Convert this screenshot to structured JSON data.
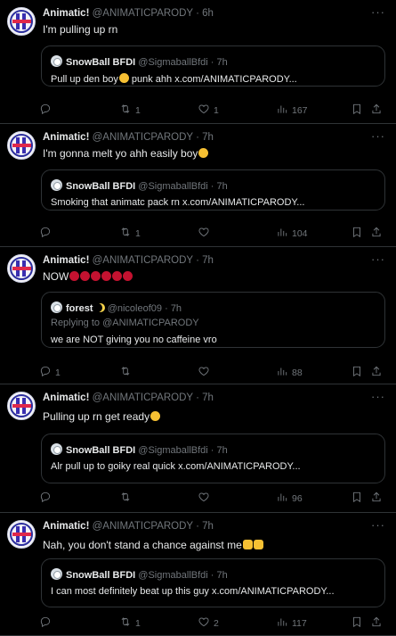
{
  "tweets": [
    {
      "name": "Animatic!",
      "handle": "@ANIMATICPARODY",
      "sep": "·",
      "time": "6h",
      "text": "I'm pulling up rn",
      "emojis": [],
      "quote": {
        "name": "SnowBall BFDI",
        "handle": "@SigmaballBfdi",
        "sep": "·",
        "time": "7h",
        "reply_to": "",
        "text_before": "Pull up den boy",
        "emoji": "yellow",
        "text_after": " punk ahh x.com/ANIMATICPARODY..."
      },
      "stats": {
        "replies": "",
        "retweets": "1",
        "likes": "1",
        "views": "167"
      }
    },
    {
      "name": "Animatic!",
      "handle": "@ANIMATICPARODY",
      "sep": "·",
      "time": "7h",
      "text": "I'm gonna melt yo ahh easily boy",
      "emojis": [
        "yellow"
      ],
      "quote": {
        "name": "SnowBall BFDI",
        "handle": "@SigmaballBfdi",
        "sep": "·",
        "time": "7h",
        "reply_to": "",
        "text_before": "Smoking that animatc pack rn x.com/ANIMATICPARODY...",
        "emoji": "",
        "text_after": ""
      },
      "stats": {
        "replies": "",
        "retweets": "1",
        "likes": "",
        "views": "104"
      }
    },
    {
      "name": "Animatic!",
      "handle": "@ANIMATICPARODY",
      "sep": "·",
      "time": "7h",
      "text": "NOW",
      "emojis": [
        "red",
        "red",
        "red",
        "red",
        "red",
        "red"
      ],
      "quote": {
        "name": "forest",
        "handle": "@nicoleof09",
        "sep": "·",
        "time": "7h",
        "reply_to": "Replying to @ANIMATICPARODY",
        "text_before": "we are NOT giving you no caffeine vro",
        "emoji": "",
        "text_after": ""
      },
      "stats": {
        "replies": "1",
        "retweets": "",
        "likes": "",
        "views": "88"
      }
    },
    {
      "name": "Animatic!",
      "handle": "@ANIMATICPARODY",
      "sep": "·",
      "time": "7h",
      "text": "Pulling up rn get ready",
      "emojis": [
        "yellow"
      ],
      "quote": {
        "name": "SnowBall BFDI",
        "handle": "@SigmaballBfdi",
        "sep": "·",
        "time": "7h",
        "reply_to": "",
        "text_before": "Alr pull up to goiky real quick x.com/ANIMATICPARODY...",
        "emoji": "",
        "text_after": ""
      },
      "stats": {
        "replies": "",
        "retweets": "",
        "likes": "",
        "views": "96"
      }
    },
    {
      "name": "Animatic!",
      "handle": "@ANIMATICPARODY",
      "sep": "·",
      "time": "7h",
      "text": "Nah, you don't stand a chance against me",
      "emojis": [
        "flex",
        "flex"
      ],
      "quote": {
        "name": "SnowBall BFDI",
        "handle": "@SigmaballBfdi",
        "sep": "·",
        "time": "7h",
        "reply_to": "",
        "text_before": "I can most definitely beat up this guy x.com/ANIMATICPARODY...",
        "emoji": "",
        "text_after": ""
      },
      "stats": {
        "replies": "",
        "retweets": "1",
        "likes": "2",
        "views": "117"
      }
    }
  ],
  "colors": {
    "background": "#000000",
    "text": "#e7e9ea",
    "muted": "#71767b",
    "border": "#2f3336"
  },
  "icons": [
    "more-icon",
    "reply-icon",
    "retweet-icon",
    "like-icon",
    "views-icon",
    "bookmark-icon",
    "share-icon"
  ]
}
